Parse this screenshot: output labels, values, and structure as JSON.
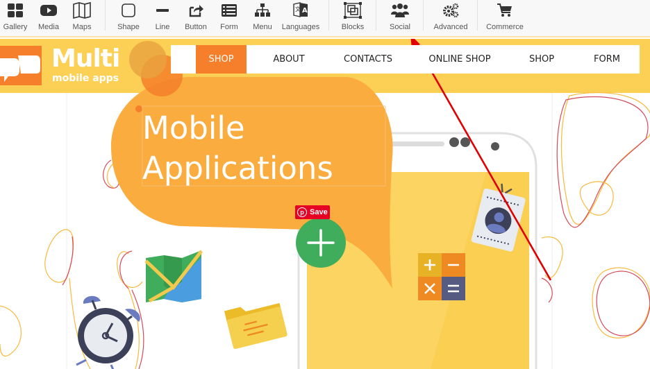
{
  "toolbar": {
    "items": [
      {
        "label": "Gallery",
        "icon": "gallery-icon"
      },
      {
        "label": "Media",
        "icon": "media-icon"
      },
      {
        "label": "Maps",
        "icon": "maps-icon"
      },
      {
        "label": "Shape",
        "icon": "shape-icon"
      },
      {
        "label": "Line",
        "icon": "line-icon"
      },
      {
        "label": "Button",
        "icon": "button-icon"
      },
      {
        "label": "Form",
        "icon": "form-icon"
      },
      {
        "label": "Menu",
        "icon": "menu-icon"
      },
      {
        "label": "Languages",
        "icon": "languages-icon"
      },
      {
        "label": "Blocks",
        "icon": "blocks-icon"
      },
      {
        "label": "Social",
        "icon": "social-icon"
      },
      {
        "label": "Advanced",
        "icon": "advanced-icon"
      },
      {
        "label": "Commerce",
        "icon": "commerce-icon"
      }
    ]
  },
  "site": {
    "logo_title": "Multi",
    "logo_subtitle": "mobile apps",
    "nav": [
      {
        "label": "SHOP",
        "active": true
      },
      {
        "label": "ABOUT"
      },
      {
        "label": "CONTACTS"
      },
      {
        "label": "ONLINE SHOP"
      },
      {
        "label": "SHOP"
      },
      {
        "label": "FORM"
      }
    ],
    "hero_line1": "Mobile",
    "hero_line2": "Applications",
    "pinterest_save": "Save",
    "pinterest_glyph": "p"
  },
  "colors": {
    "accent_orange": "#f57f2a",
    "bubble_orange": "#fbac3f",
    "band_yellow": "#fcd055",
    "annotation_arrow": "#e00000",
    "pinterest_red": "#e60023",
    "plus_green": "#3fad5b"
  }
}
